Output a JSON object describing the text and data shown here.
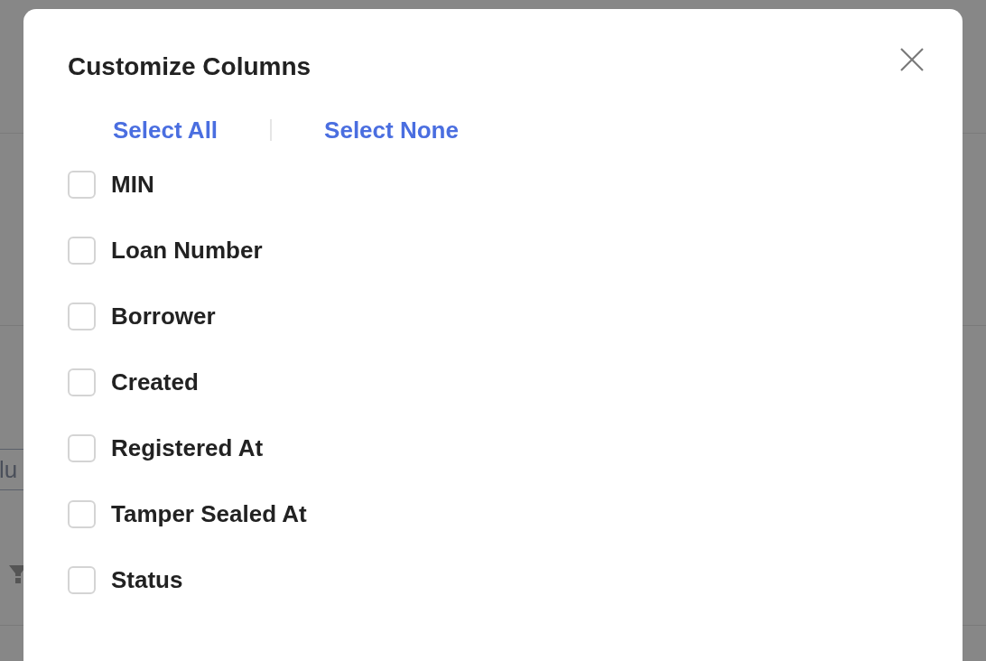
{
  "background": {
    "field_text": "lu"
  },
  "dialog": {
    "title": "Customize Columns",
    "select_all": "Select All",
    "select_none": "Select None",
    "columns": [
      {
        "label": "MIN",
        "checked": false
      },
      {
        "label": "Loan Number",
        "checked": false
      },
      {
        "label": "Borrower",
        "checked": false
      },
      {
        "label": "Created",
        "checked": false
      },
      {
        "label": "Registered At",
        "checked": false
      },
      {
        "label": "Tamper Sealed At",
        "checked": false
      },
      {
        "label": "Status",
        "checked": false
      }
    ]
  }
}
